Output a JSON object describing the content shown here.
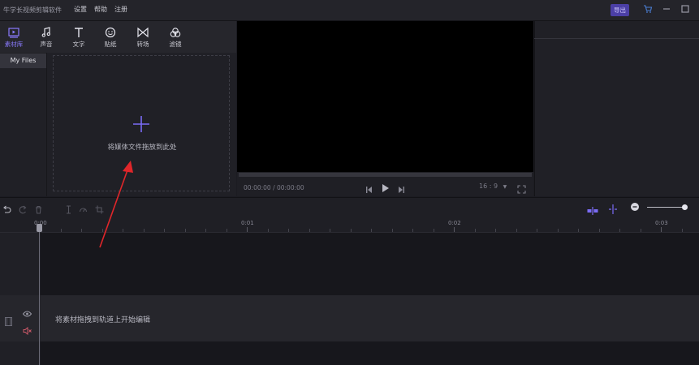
{
  "app": {
    "title": "牛学长视频剪辑软件"
  },
  "menu": {
    "items": [
      "设置",
      "帮助",
      "注册"
    ]
  },
  "export_label": "导出",
  "tools": [
    {
      "label": "素材库",
      "icon": "media-library-icon",
      "active": true
    },
    {
      "label": "声音",
      "icon": "music-note-icon",
      "active": false
    },
    {
      "label": "文字",
      "icon": "text-icon",
      "active": false
    },
    {
      "label": "贴纸",
      "icon": "sticker-icon",
      "active": false
    },
    {
      "label": "转场",
      "icon": "transition-icon",
      "active": false
    },
    {
      "label": "滤镜",
      "icon": "filter-icon",
      "active": false
    }
  ],
  "nav": {
    "my_files": "My Files"
  },
  "media": {
    "drop_hint": "将媒体文件拖放到此处"
  },
  "player": {
    "timecode": "00:00:00 / 00:00:00",
    "aspect_ratio": "16 : 9"
  },
  "timeline": {
    "ruler_labels": [
      "0:00",
      "0:01",
      "0:02",
      "0:03"
    ],
    "main_track_hint": "将素材拖拽到轨道上开始编辑"
  },
  "colors": {
    "accent": "#7b6cf6",
    "annotation_arrow": "#e0262a"
  }
}
